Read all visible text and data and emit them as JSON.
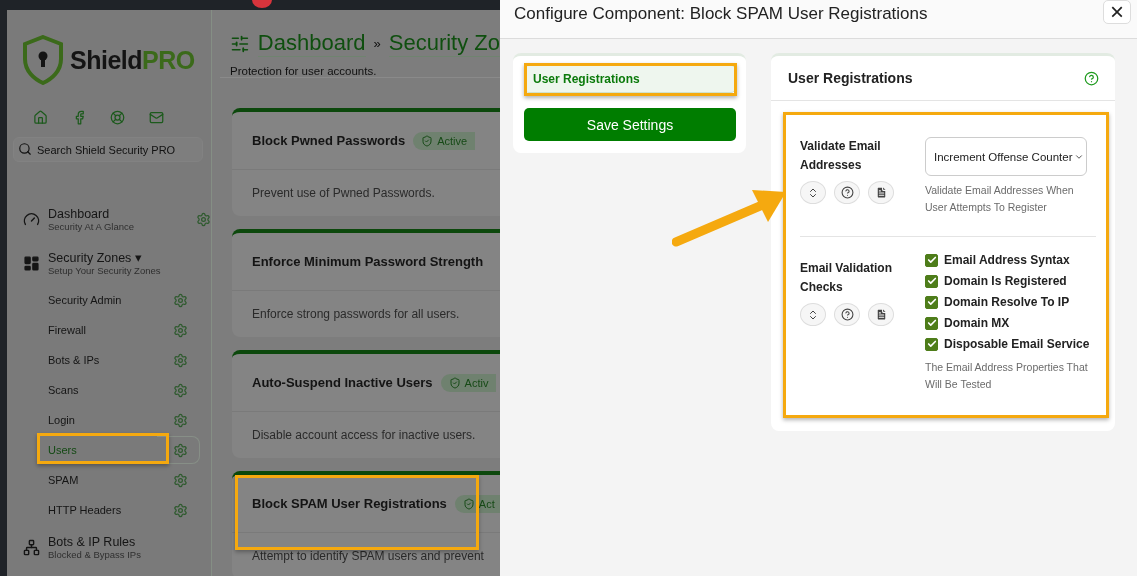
{
  "backdrop": {
    "notification_dot": true
  },
  "sidebar": {
    "logo": {
      "name": "Shield",
      "suffix": "PRO"
    },
    "quick_links": [
      {
        "kind": "home"
      },
      {
        "kind": "facebook"
      },
      {
        "kind": "support"
      },
      {
        "kind": "mail"
      }
    ],
    "search": {
      "placeholder": "Search Shield Security PRO"
    },
    "items": [
      {
        "label": "Dashboard",
        "caption": "Security At A Glance",
        "gear": true
      },
      {
        "label": "Security Zones",
        "caption": "Setup Your Security Zones",
        "caret": "▾",
        "gear": false,
        "children": [
          {
            "label": "Security Admin",
            "selected": false,
            "highlighted": false
          },
          {
            "label": "Firewall",
            "selected": false,
            "highlighted": false
          },
          {
            "label": "Bots & IPs",
            "selected": false,
            "highlighted": false
          },
          {
            "label": "Scans",
            "selected": false,
            "highlighted": false
          },
          {
            "label": "Login",
            "selected": false,
            "highlighted": false
          },
          {
            "label": "Users",
            "selected": true,
            "highlighted": true
          },
          {
            "label": "SPAM",
            "selected": false,
            "highlighted": false
          },
          {
            "label": "HTTP Headers",
            "selected": false,
            "highlighted": false
          }
        ]
      },
      {
        "label": "Bots & IP Rules",
        "caption": "Blocked & Bypass IPs",
        "gear": false
      }
    ]
  },
  "main": {
    "breadcrumb": [
      "Dashboard",
      "Security Zo"
    ],
    "separator": "»",
    "subtitle": "Protection for user accounts.",
    "cards": [
      {
        "title": "Block Pwned Passwords",
        "badge": "Active",
        "description": "Prevent use of Pwned Passwords.",
        "highlighted": false
      },
      {
        "title": "Enforce Minimum Password Strength",
        "description": "Enforce strong passwords for all users.",
        "highlighted": false
      },
      {
        "title": "Auto-Suspend Inactive Users",
        "badge": "Activ",
        "description": "Disable account access for inactive users.",
        "highlighted": false
      },
      {
        "title": "Block SPAM User Registrations",
        "badge": "Act",
        "description": "Attempt to identify SPAM users and prevent",
        "highlighted": true
      }
    ]
  },
  "dialog": {
    "title": "Configure Component: Block SPAM User Registrations",
    "close": "×",
    "tabs": [
      {
        "label": "User Registrations",
        "selected": true,
        "highlighted": true
      }
    ],
    "save_button": "Save Settings",
    "panel": {
      "title": "User Registrations",
      "highlighted": true,
      "options": [
        {
          "kind": "select",
          "label": "Validate Email Addresses",
          "value": "Increment Offense Counter",
          "hint": "Validate Email Addresses When User Attempts To Register"
        },
        {
          "kind": "checklist",
          "label": "Email Validation Checks",
          "checks": [
            {
              "label": "Email Address Syntax",
              "checked": true
            },
            {
              "label": "Domain Is Registered",
              "checked": true
            },
            {
              "label": "Domain Resolve To IP",
              "checked": true
            },
            {
              "label": "Domain MX",
              "checked": true
            },
            {
              "label": "Disposable Email Service",
              "checked": true
            }
          ],
          "hint": "The Email Address Properties That Will Be Tested"
        }
      ]
    }
  },
  "callout_arrow": true
}
